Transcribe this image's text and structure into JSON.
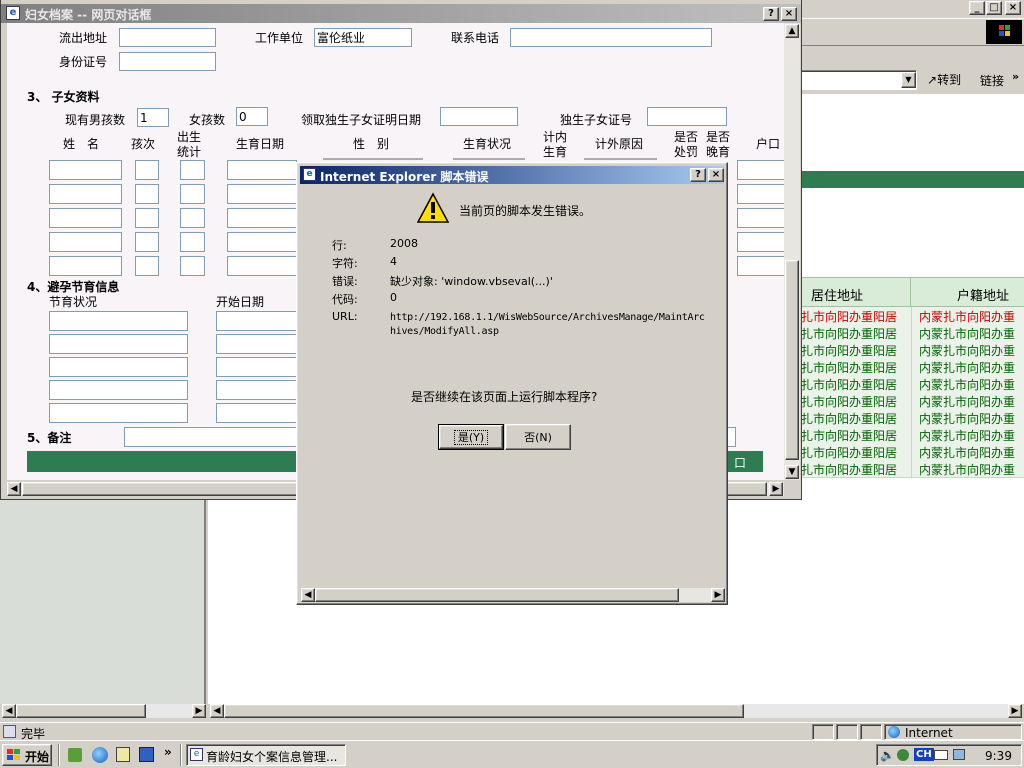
{
  "ie_window": {
    "controls": [
      "_",
      "□",
      "×"
    ],
    "go_label": "转到",
    "links_label": "链接",
    "table_headers": [
      "居住地址",
      "户籍地址"
    ],
    "rows": [
      {
        "residence": "扎市向阳办重阳居",
        "registered": "内蒙扎市向阳办重"
      },
      {
        "residence": "扎市向阳办重阳居",
        "registered": "内蒙扎市向阳办重"
      },
      {
        "residence": "扎市向阳办重阳居",
        "registered": "内蒙扎市向阳办重"
      },
      {
        "residence": "扎市向阳办重阳居",
        "registered": "内蒙扎市向阳办重"
      },
      {
        "residence": "扎市向阳办重阳居",
        "registered": "内蒙扎市向阳办重"
      },
      {
        "residence": "扎市向阳办重阳居",
        "registered": "内蒙扎市向阳办重"
      },
      {
        "residence": "扎市向阳办重阳居",
        "registered": "内蒙扎市向阳办重"
      },
      {
        "residence": "扎市向阳办重阳居",
        "registered": "内蒙扎市向阳办重"
      },
      {
        "residence": "扎市向阳办重阳居",
        "registered": "内蒙扎市向阳办重"
      },
      {
        "residence": "扎市向阳办重阳居",
        "registered": "内蒙扎市向阳办重"
      }
    ],
    "status_text": "完毕",
    "zone_text": "Internet",
    "colors": {
      "row_highlight": "#cc0000",
      "row_text": "#006400",
      "green_bar": "#2e7d52"
    }
  },
  "dialog": {
    "title": "妇女档案 -- 网页对话框",
    "help": "?",
    "close": "×",
    "fields": {
      "outflow_label": "流出地址",
      "outflow_value": "",
      "work_label": "工作单位",
      "work_value": "富伦纸业",
      "phone_label": "联系电话",
      "phone_value": "",
      "id_label": "身份证号",
      "id_value": ""
    },
    "section3": {
      "title": "3、 子女资料",
      "boys_label": "现有男孩数",
      "boys_value": "1",
      "girls_label": "女孩数",
      "girls_value": "0",
      "cert_date_label": "领取独生子女证明日期",
      "cert_no_label": "独生子女证号",
      "headers": {
        "name": "姓　名",
        "order": "孩次",
        "birth_stat_1": "出生",
        "birth_stat_2": "统计",
        "birth_date": "生育日期",
        "gender": "性　别",
        "status": "生育状况",
        "plan_1": "计内",
        "plan_2": "生育",
        "reason": "计外原因",
        "punish_1": "是否",
        "punish_2": "处罚",
        "late_1": "是否",
        "late_2": "晚育",
        "hukou": "户口"
      }
    },
    "section4": {
      "title": "4、避孕节育信息",
      "col1": "节育状况",
      "col2": "开始日期"
    },
    "section5": {
      "title": "5、备注"
    },
    "close_window_label": "口"
  },
  "error_dialog": {
    "title": "Internet Explorer 脚本错误",
    "help": "?",
    "close": "×",
    "message": "当前页的脚本发生错误。",
    "line_label": "行:",
    "line_value": "2008",
    "char_label": "字符:",
    "char_value": "4",
    "error_label": "错误:",
    "error_value": "缺少对象: 'window.vbseval(...)'",
    "code_label": "代码:",
    "code_value": "0",
    "url_label": "URL:",
    "url_value_1": "http://192.168.1.1/WisWebSource/ArchivesManage/MaintArc",
    "url_value_2": "hives/ModifyAll.asp",
    "question": "是否继续在该页面上运行脚本程序?",
    "yes_label": "是(Y)",
    "no_label": "否(N)"
  },
  "taskbar": {
    "start_label": "开始",
    "task_label": "育龄妇女个案信息管理...",
    "ime_label": "CH",
    "clock": "9:39"
  }
}
